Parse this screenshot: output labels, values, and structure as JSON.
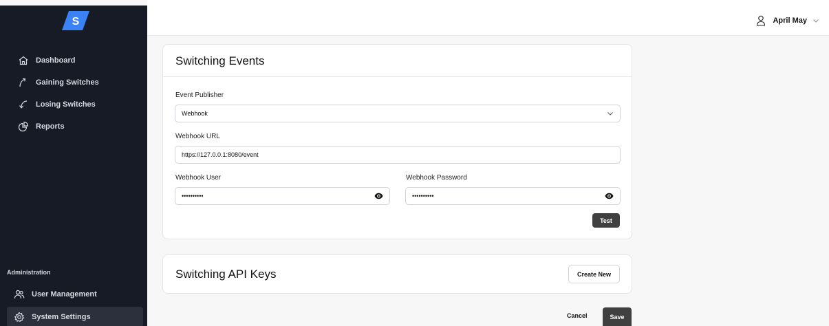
{
  "sidebar": {
    "logo_text": "S",
    "items": [
      {
        "label": "Dashboard",
        "icon": "home-icon"
      },
      {
        "label": "Gaining Switches",
        "icon": "arrow-up-curve-icon"
      },
      {
        "label": "Losing Switches",
        "icon": "arrow-down-curve-icon"
      },
      {
        "label": "Reports",
        "icon": "pie-chart-icon"
      }
    ],
    "admin_label": "Administration",
    "admin_items": [
      {
        "label": "User Management",
        "icon": "users-icon"
      },
      {
        "label": "System Settings",
        "icon": "gear-icon",
        "active": true
      }
    ]
  },
  "header": {
    "user_name": "April May"
  },
  "events_card": {
    "title": "Switching Events",
    "publisher_label": "Event Publisher",
    "publisher_value": "Webhook",
    "url_label": "Webhook URL",
    "url_value": "https://127.0.0.1:8080/event",
    "user_label": "Webhook User",
    "user_value": "••••••••••",
    "password_label": "Webhook Password",
    "password_value": "••••••••••",
    "test_label": "Test"
  },
  "keys_card": {
    "title": "Switching API Keys",
    "create_label": "Create New"
  },
  "footer": {
    "cancel_label": "Cancel",
    "save_label": "Save"
  },
  "colors": {
    "sidebar_bg": "#161b26",
    "logo_blue": "#3b82f6",
    "dark_button": "#404040"
  }
}
